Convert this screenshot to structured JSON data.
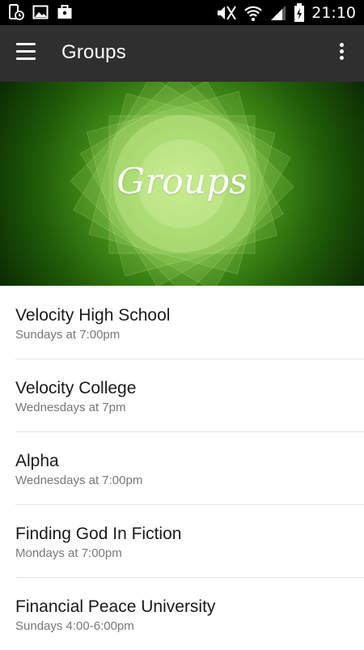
{
  "status_bar": {
    "time": "21:10",
    "left_icons": [
      "phone-clock-icon",
      "image-icon",
      "briefcase-icon"
    ],
    "right_icons": [
      "mute-icon",
      "wifi-icon",
      "signal-icon",
      "battery-charging-icon"
    ]
  },
  "app_bar": {
    "title": "Groups",
    "menu_icon": "hamburger-menu-icon",
    "overflow_icon": "overflow-menu-icon"
  },
  "hero": {
    "title": "Groups"
  },
  "groups": [
    {
      "name": "Velocity High School",
      "schedule": "Sundays at 7:00pm"
    },
    {
      "name": "Velocity College",
      "schedule": "Wednesdays at 7pm"
    },
    {
      "name": "Alpha",
      "schedule": "Wednesdays at 7:00pm"
    },
    {
      "name": "Finding God In Fiction",
      "schedule": "Mondays at 7:00pm"
    },
    {
      "name": "Financial Peace University",
      "schedule": "Sundays 4:00-6:00pm"
    }
  ],
  "colors": {
    "status_bar": "#000000",
    "app_bar": "#2f2f2f",
    "hero_green": "#4c9a1c",
    "divider": "#e3e3e3"
  }
}
